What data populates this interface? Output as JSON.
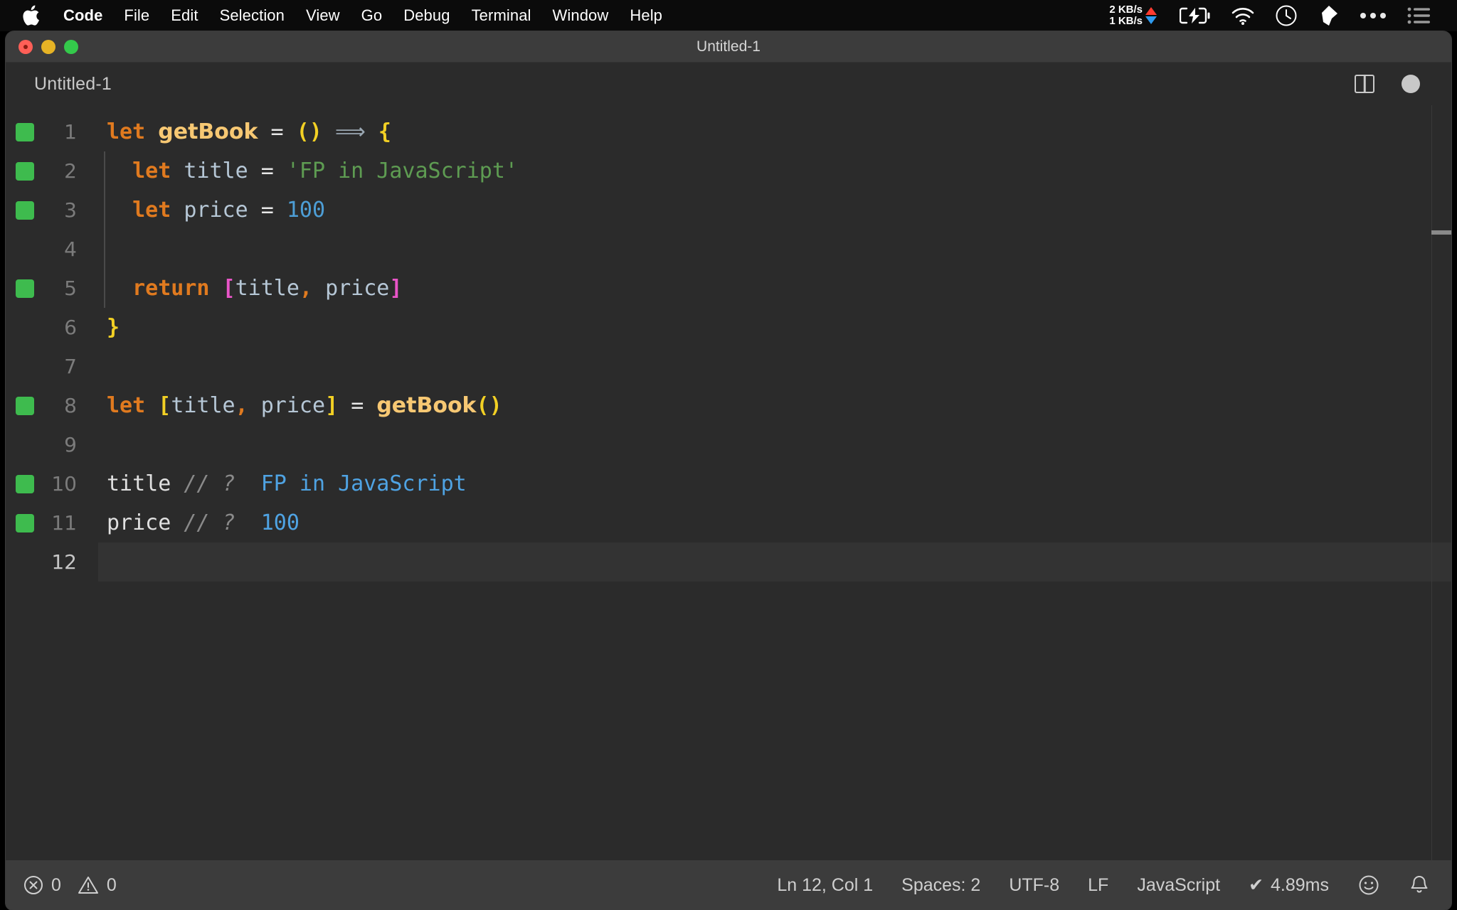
{
  "menubar": {
    "apple_icon": "apple-logo",
    "items": [
      {
        "label": "Code",
        "bold": true
      },
      {
        "label": "File"
      },
      {
        "label": "Edit"
      },
      {
        "label": "Selection"
      },
      {
        "label": "View"
      },
      {
        "label": "Go"
      },
      {
        "label": "Debug"
      },
      {
        "label": "Terminal"
      },
      {
        "label": "Window"
      },
      {
        "label": "Help"
      }
    ],
    "status": {
      "net_up": "2 KB/s",
      "net_down": "1 KB/s",
      "net_up_color": "#ff3b30",
      "net_down_color": "#2e9bf0",
      "icons": [
        "battery-charging-icon",
        "wifi-icon",
        "clock-icon",
        "dropbox-icon",
        "ellipsis-icon",
        "control-center-icon"
      ]
    }
  },
  "window": {
    "title": "Untitled-1",
    "traffic_lights": [
      "close-button",
      "minimize-button",
      "maximize-button"
    ]
  },
  "tabbar": {
    "tab_label": "Untitled-1",
    "split_editor_icon": "split-editor-icon",
    "unsaved_indicator": "unsaved-dot-icon"
  },
  "editor": {
    "language": "JavaScript",
    "active_line": 12,
    "lines": [
      {
        "n": "1",
        "mark": true,
        "indent": 0,
        "tokens": [
          {
            "t": "let",
            "c": "t-kw"
          },
          {
            "t": " ",
            "c": "t-plain"
          },
          {
            "t": "getBook",
            "c": "t-fn"
          },
          {
            "t": " ",
            "c": "t-plain"
          },
          {
            "t": "=",
            "c": "t-op"
          },
          {
            "t": " ",
            "c": "t-plain"
          },
          {
            "t": "()",
            "c": "t-yellow"
          },
          {
            "t": " ",
            "c": "t-plain"
          },
          {
            "t": "⟹",
            "c": "t-arrow"
          },
          {
            "t": " ",
            "c": "t-plain"
          },
          {
            "t": "{",
            "c": "t-yellow"
          }
        ]
      },
      {
        "n": "2",
        "mark": true,
        "indent": 1,
        "tokens": [
          {
            "t": "  ",
            "c": "t-plain"
          },
          {
            "t": "let",
            "c": "t-kw"
          },
          {
            "t": " ",
            "c": "t-plain"
          },
          {
            "t": "title",
            "c": "t-var"
          },
          {
            "t": " ",
            "c": "t-plain"
          },
          {
            "t": "=",
            "c": "t-op"
          },
          {
            "t": " ",
            "c": "t-plain"
          },
          {
            "t": "'FP in JavaScript'",
            "c": "t-str"
          }
        ]
      },
      {
        "n": "3",
        "mark": true,
        "indent": 1,
        "tokens": [
          {
            "t": "  ",
            "c": "t-plain"
          },
          {
            "t": "let",
            "c": "t-kw"
          },
          {
            "t": " ",
            "c": "t-plain"
          },
          {
            "t": "price",
            "c": "t-var"
          },
          {
            "t": " ",
            "c": "t-plain"
          },
          {
            "t": "=",
            "c": "t-op"
          },
          {
            "t": " ",
            "c": "t-plain"
          },
          {
            "t": "100",
            "c": "t-num"
          }
        ]
      },
      {
        "n": "4",
        "mark": false,
        "indent": 1,
        "tokens": []
      },
      {
        "n": "5",
        "mark": true,
        "indent": 1,
        "tokens": [
          {
            "t": "  ",
            "c": "t-plain"
          },
          {
            "t": "return",
            "c": "t-kw"
          },
          {
            "t": " ",
            "c": "t-plain"
          },
          {
            "t": "[",
            "c": "t-magenta"
          },
          {
            "t": "title",
            "c": "t-var"
          },
          {
            "t": ",",
            "c": "t-kw"
          },
          {
            "t": " ",
            "c": "t-plain"
          },
          {
            "t": "price",
            "c": "t-var"
          },
          {
            "t": "]",
            "c": "t-magenta"
          }
        ]
      },
      {
        "n": "6",
        "mark": false,
        "indent": 0,
        "tokens": [
          {
            "t": "}",
            "c": "t-yellow"
          }
        ]
      },
      {
        "n": "7",
        "mark": false,
        "indent": 0,
        "tokens": []
      },
      {
        "n": "8",
        "mark": true,
        "indent": 0,
        "tokens": [
          {
            "t": "let",
            "c": "t-kw"
          },
          {
            "t": " ",
            "c": "t-plain"
          },
          {
            "t": "[",
            "c": "t-yellow"
          },
          {
            "t": "title",
            "c": "t-var"
          },
          {
            "t": ",",
            "c": "t-kw"
          },
          {
            "t": " ",
            "c": "t-plain"
          },
          {
            "t": "price",
            "c": "t-var"
          },
          {
            "t": "]",
            "c": "t-yellow"
          },
          {
            "t": " ",
            "c": "t-plain"
          },
          {
            "t": "=",
            "c": "t-op"
          },
          {
            "t": " ",
            "c": "t-plain"
          },
          {
            "t": "getBook",
            "c": "t-fn"
          },
          {
            "t": "()",
            "c": "t-yellow"
          }
        ]
      },
      {
        "n": "9",
        "mark": false,
        "indent": 0,
        "tokens": []
      },
      {
        "n": "10",
        "mark": true,
        "indent": 0,
        "tokens": [
          {
            "t": "title",
            "c": "t-plain"
          },
          {
            "t": " ",
            "c": "t-plain"
          },
          {
            "t": "// ?",
            "c": "t-comment"
          },
          {
            "t": "  ",
            "c": "t-plain"
          },
          {
            "t": "FP in JavaScript",
            "c": "t-quokka"
          }
        ]
      },
      {
        "n": "11",
        "mark": true,
        "indent": 0,
        "tokens": [
          {
            "t": "price",
            "c": "t-plain"
          },
          {
            "t": " ",
            "c": "t-plain"
          },
          {
            "t": "// ?",
            "c": "t-comment"
          },
          {
            "t": "  ",
            "c": "t-plain"
          },
          {
            "t": "100",
            "c": "t-quokka"
          }
        ]
      },
      {
        "n": "12",
        "mark": false,
        "indent": 0,
        "active": true,
        "tokens": []
      }
    ]
  },
  "statusbar": {
    "error_icon": "error-circle-icon",
    "error_count": "0",
    "warning_icon": "warning-triangle-icon",
    "warning_count": "0",
    "cursor_position": "Ln 12, Col 1",
    "indentation": "Spaces: 2",
    "encoding": "UTF-8",
    "eol": "LF",
    "language_mode": "JavaScript",
    "quokka_check": "✔",
    "quokka_time": "4.89ms",
    "feedback_icon": "smiley-icon",
    "notifications_icon": "bell-icon"
  },
  "colors": {
    "menubar_bg": "#0b0b0b",
    "titlebar_bg": "#3c3c3c",
    "editor_bg": "#2b2b2b",
    "statusbar_bg": "#3c3c3c",
    "gutter_mark": "#3ebb4e",
    "keyword": "#e07a1f",
    "string": "#5e9c52",
    "number": "#4d9ed6",
    "quokka_value": "#4fa3e3"
  }
}
